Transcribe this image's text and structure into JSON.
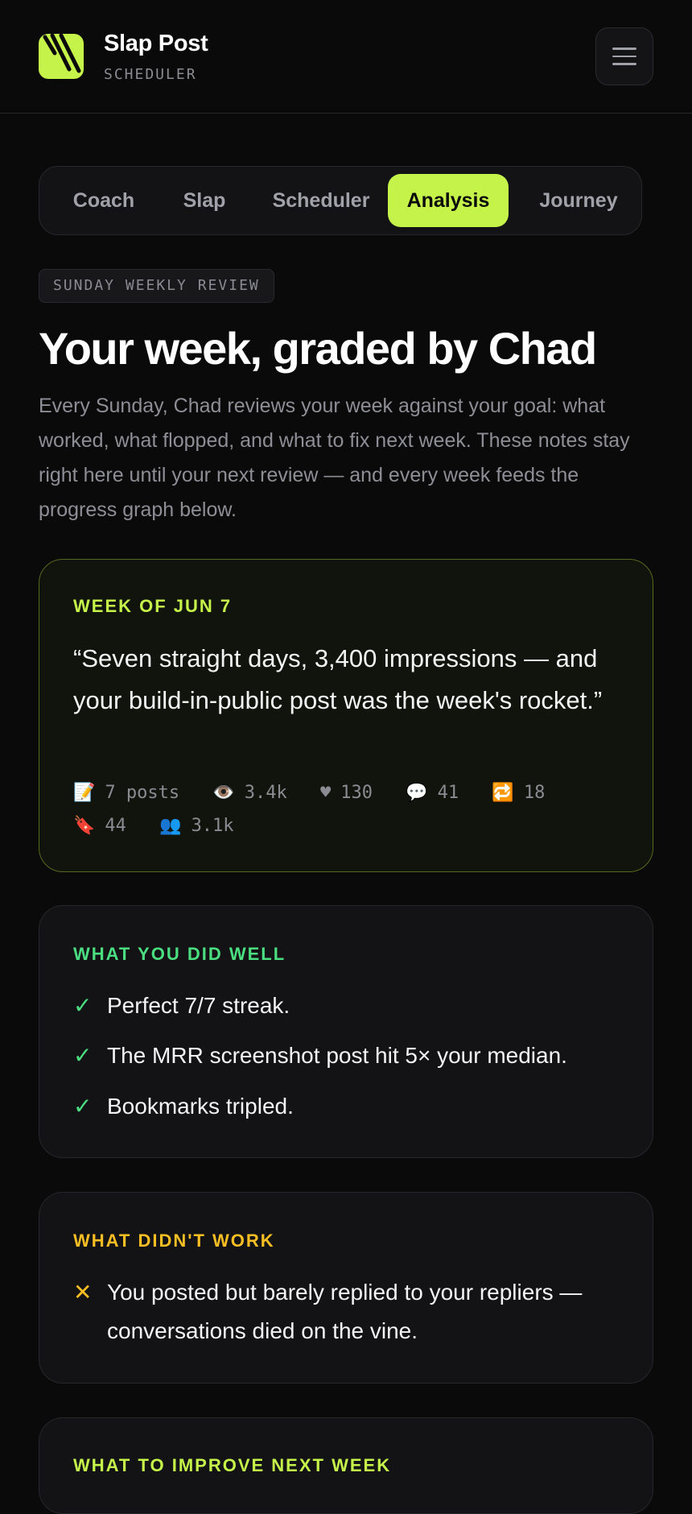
{
  "header": {
    "brand_name": "Slap Post",
    "brand_sub": "SCHEDULER",
    "logo_icon": "slash-logo-icon",
    "menu_icon": "hamburger-menu-icon"
  },
  "tabs": [
    {
      "label": "Coach",
      "active": false
    },
    {
      "label": "Slap",
      "active": false
    },
    {
      "label": "Scheduler",
      "active": false
    },
    {
      "label": "Analysis",
      "active": true
    },
    {
      "label": "Journey",
      "active": false
    }
  ],
  "review": {
    "pill": "SUNDAY WEEKLY REVIEW",
    "title": "Your week, graded by Chad",
    "intro": "Every Sunday, Chad reviews your week against your goal: what worked, what flopped, and what to fix next week. These notes stay right here until your next review — and every week feeds the progress graph below."
  },
  "week": {
    "label": "WEEK OF JUN 7",
    "quote": "“Seven straight days, 3,400 impressions — and your build-in-public post was the week's rocket.”",
    "stats": [
      {
        "icon": "📝",
        "icon_name": "memo-icon",
        "value": "7 posts"
      },
      {
        "icon": "👁️",
        "icon_name": "eye-icon",
        "value": "3.4k"
      },
      {
        "icon": "♥",
        "icon_name": "heart-icon",
        "value": "130"
      },
      {
        "icon": "💬",
        "icon_name": "speech-bubble-icon",
        "value": "41"
      },
      {
        "icon": "🔁",
        "icon_name": "repost-icon",
        "value": "18"
      },
      {
        "icon": "🔖",
        "icon_name": "bookmark-icon",
        "value": "44"
      },
      {
        "icon": "👥",
        "icon_name": "followers-icon",
        "value": "3.1k"
      }
    ]
  },
  "did_well": {
    "label": "WHAT YOU DID WELL",
    "items": [
      "Perfect 7/7 streak.",
      "The MRR screenshot post hit 5× your median.",
      "Bookmarks tripled."
    ]
  },
  "didnt_work": {
    "label": "WHAT DIDN'T WORK",
    "items": [
      "You posted but barely replied to your repliers — conversations died on the vine."
    ]
  },
  "improve": {
    "label": "WHAT TO IMPROVE NEXT WEEK"
  },
  "colors": {
    "accent": "#c6f34a",
    "good": "#4ade80",
    "bad": "#fbbf24",
    "background": "#0a0a0b"
  }
}
